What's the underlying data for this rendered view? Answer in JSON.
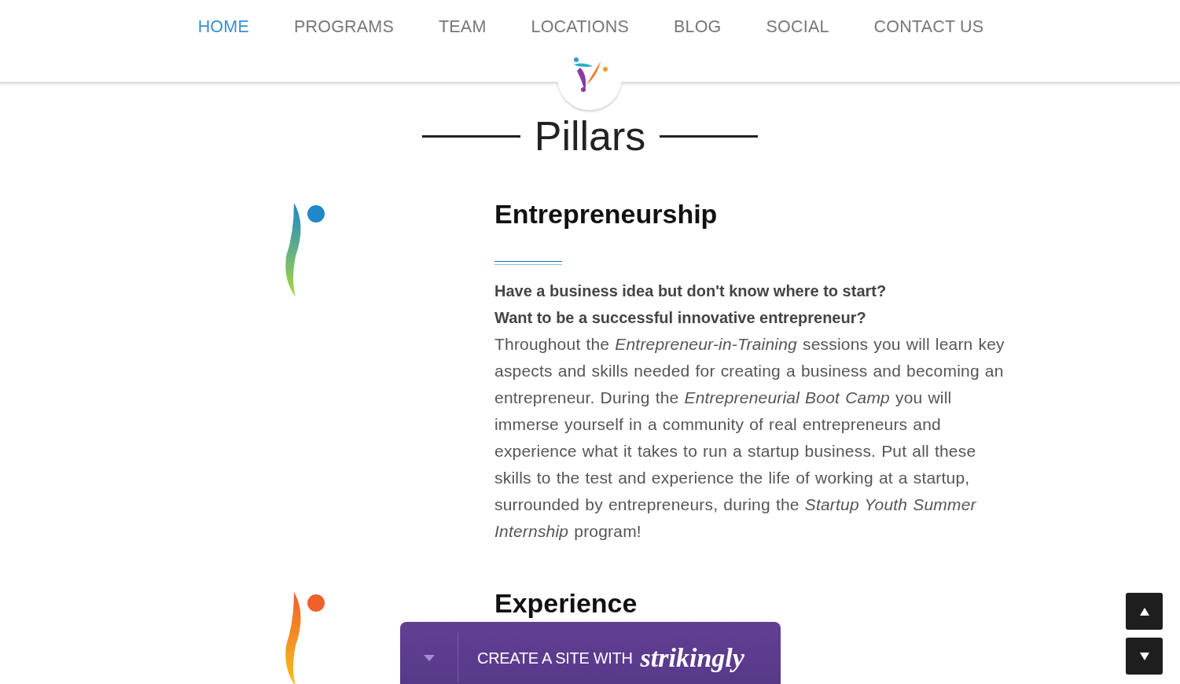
{
  "nav": {
    "items": [
      {
        "label": "HOME",
        "selected": true
      },
      {
        "label": "PROGRAMS",
        "selected": false
      },
      {
        "label": "TEAM",
        "selected": false
      },
      {
        "label": "LOCATIONS",
        "selected": false
      },
      {
        "label": "BLOG",
        "selected": false
      },
      {
        "label": "SOCIAL",
        "selected": false
      },
      {
        "label": "CONTACT US",
        "selected": false
      }
    ]
  },
  "section_title": "Pillars",
  "pillars": [
    {
      "heading": "Entrepreneurship",
      "color": "#1e88c8",
      "lead": [
        "Have a business idea but don't know where to start?",
        "Want to be a successful innovative entrepreneur?"
      ],
      "body": "Throughout the *Entrepreneur-in-Training* sessions you will learn key aspects and skills needed for creating a business and becoming an entrepreneur. During the *Entrepreneurial Boot Camp* you will immerse yourself in a community of real entrepreneurs and experience what it takes to run a startup business. Put all these skills to the test and experience the life of working at a startup, surrounded by entrepreneurs, during the *Startup Youth Summer Internship* program!"
    },
    {
      "heading": "Experience",
      "color": "#f0602a"
    }
  ],
  "banner": {
    "text": "CREATE A SITE WITH",
    "brand": "strikingly"
  }
}
